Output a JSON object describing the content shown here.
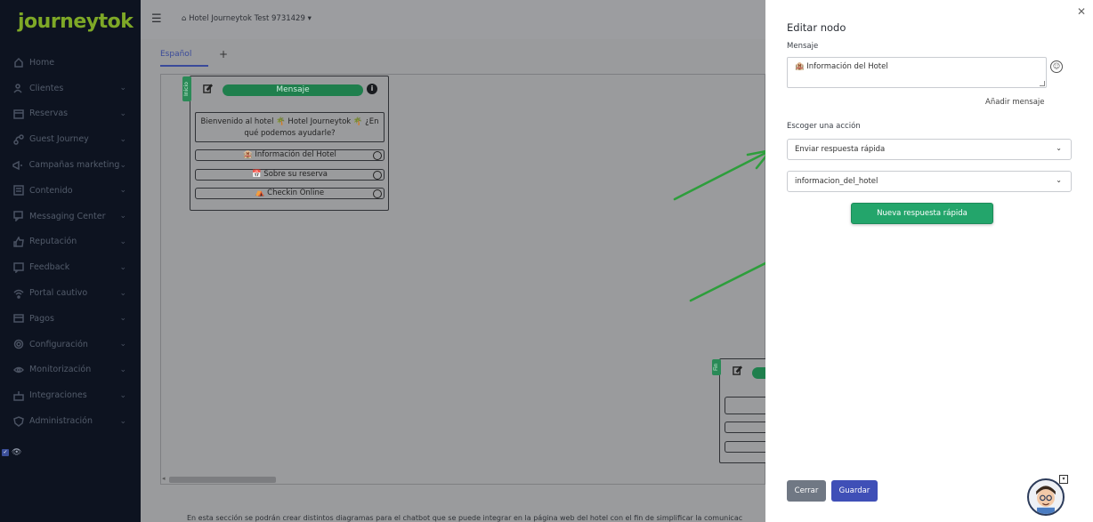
{
  "app": {
    "logo": "journeytok"
  },
  "sidebar": {
    "items": [
      {
        "label": "Home",
        "icon": "home-icon",
        "has_chevron": false
      },
      {
        "label": "Clientes",
        "icon": "users-icon",
        "has_chevron": true
      },
      {
        "label": "Reservas",
        "icon": "calendar-icon",
        "has_chevron": true
      },
      {
        "label": "Guest Journey",
        "icon": "journey-icon",
        "has_chevron": true
      },
      {
        "label": "Campañas marketing",
        "icon": "megaphone-icon",
        "has_chevron": true
      },
      {
        "label": "Contenido",
        "icon": "content-icon",
        "has_chevron": true
      },
      {
        "label": "Messaging Center",
        "icon": "chat-icon",
        "has_chevron": true
      },
      {
        "label": "Reputación",
        "icon": "thumbs-up-icon",
        "has_chevron": true
      },
      {
        "label": "Feedback",
        "icon": "feedback-icon",
        "has_chevron": true
      },
      {
        "label": "Portal cautivo",
        "icon": "wifi-icon",
        "has_chevron": true
      },
      {
        "label": "Pagos",
        "icon": "payments-icon",
        "has_chevron": true
      },
      {
        "label": "Configuración",
        "icon": "gear-icon",
        "has_chevron": true
      },
      {
        "label": "Monitorización",
        "icon": "eye-icon",
        "has_chevron": true
      },
      {
        "label": "Integraciones",
        "icon": "integrations-icon",
        "has_chevron": true
      },
      {
        "label": "Administración",
        "icon": "shield-icon",
        "has_chevron": true
      }
    ]
  },
  "topbar": {
    "hotel": "Hotel Journeytok Test 9731429",
    "hotel_icon": "home-icon"
  },
  "tabs": {
    "active": "Español",
    "add": "+"
  },
  "flow": {
    "start_node": {
      "tag": "Inicio",
      "title": "Mensaje",
      "welcome": "Bienvenido al hotel 🌴 Hotel Journeytok 🌴 ¿En qué podemos ayudarle?",
      "quick_replies": [
        "🏨 Información del Hotel",
        "📅 Sobre su reserva",
        "⛺ Checkin Online"
      ]
    },
    "end_node": {
      "tag": "Fin"
    }
  },
  "footer": {
    "text": "En esta sección se podrán crear distintos diagramas para el chatbot que se puede integrar en la página web del hotel con el fin de simplificar la comunicac"
  },
  "drawer": {
    "title": "Editar nodo",
    "message_label": "Mensaje",
    "message_value": "🏨 Información del Hotel",
    "add_message": "Añadir mensaje",
    "action_label": "Escoger una acción",
    "action_select": "Enviar respuesta rápida",
    "quick_reply_select": "informacion_del_hotel",
    "new_quick_reply": "Nueva respuesta rápida",
    "close_button": "Cerrar",
    "save_button": "Guardar"
  },
  "colors": {
    "sidebar_bg": "#0d1320",
    "logo": "#7ea827",
    "accent_green": "#23a56b",
    "primary_blue": "#3f4fb7",
    "arrow_green": "#2e9e3c"
  }
}
